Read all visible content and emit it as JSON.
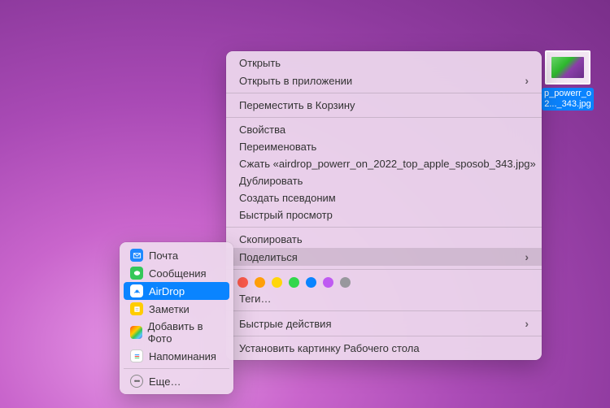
{
  "desktop": {
    "file": {
      "name_line1": "p_powerr_o",
      "name_line2": "2..._343.jpg"
    }
  },
  "context_menu": {
    "open": "Открыть",
    "open_with": "Открыть в приложении",
    "trash": "Переместить в Корзину",
    "info": "Свойства",
    "rename": "Переименовать",
    "compress": "Сжать «airdrop_powerr_on_2022_top_apple_sposob_343.jpg»",
    "duplicate": "Дублировать",
    "alias": "Создать псевдоним",
    "quicklook": "Быстрый просмотр",
    "copy": "Скопировать",
    "share": "Поделиться",
    "tags": "Теги…",
    "quick_actions": "Быстрые действия",
    "set_wallpaper": "Установить картинку Рабочего стола",
    "tag_colors": [
      "#ff5b4d",
      "#ff9f0a",
      "#ffd60a",
      "#32d74b",
      "#0a84ff",
      "#bf5af2",
      "#98989d"
    ]
  },
  "share_menu": {
    "mail": "Почта",
    "messages": "Сообщения",
    "airdrop": "AirDrop",
    "notes": "Заметки",
    "photos": "Добавить в Фото",
    "reminders": "Напоминания",
    "more": "Еще…"
  }
}
